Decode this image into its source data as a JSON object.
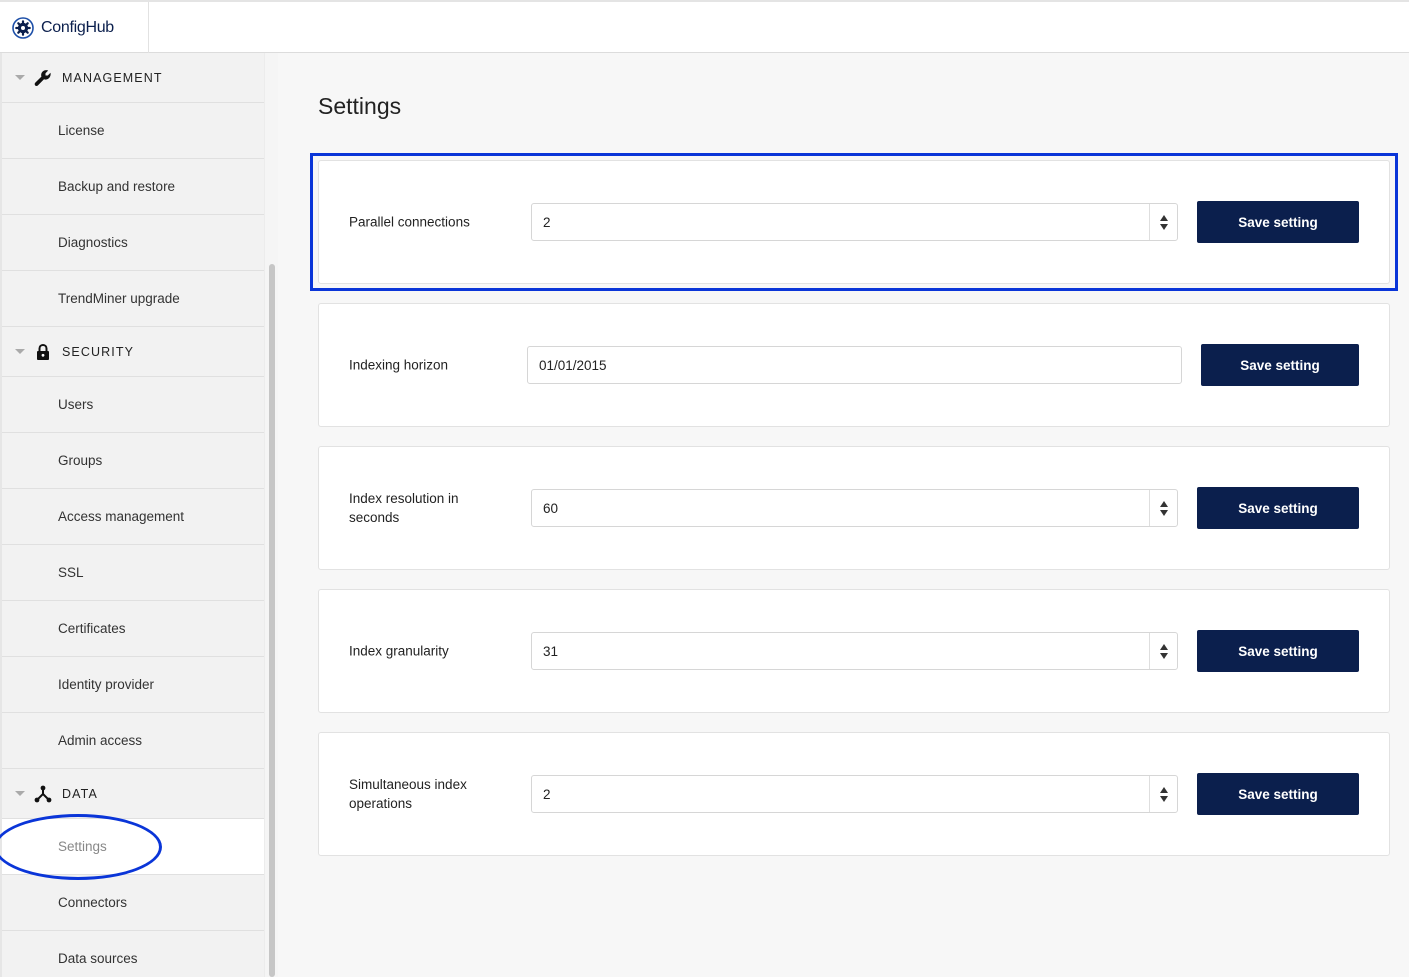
{
  "app": {
    "brand_name": "ConfigHub"
  },
  "sidebar": {
    "sections": [
      {
        "label": "MANAGEMENT",
        "icon": "wrench-icon",
        "items": [
          "License",
          "Backup and restore",
          "Diagnostics",
          "TrendMiner upgrade"
        ]
      },
      {
        "label": "SECURITY",
        "icon": "lock-icon",
        "items": [
          "Users",
          "Groups",
          "Access management",
          "SSL",
          "Certificates",
          "Identity provider",
          "Admin access"
        ]
      },
      {
        "label": "DATA",
        "icon": "network-icon",
        "items": [
          "Settings",
          "Connectors",
          "Data sources"
        ]
      }
    ],
    "active_item": "Settings"
  },
  "main": {
    "title": "Settings",
    "settings": [
      {
        "label": "Parallel connections",
        "value": "2",
        "type": "number",
        "button": "Save setting"
      },
      {
        "label": "Indexing horizon",
        "value": "01/01/2015",
        "type": "date",
        "button": "Save setting"
      },
      {
        "label": "Index resolution in seconds",
        "value": "60",
        "type": "number",
        "button": "Save setting"
      },
      {
        "label": "Index granularity",
        "value": "31",
        "type": "number",
        "button": "Save setting"
      },
      {
        "label": "Simultaneous index operations",
        "value": "2",
        "type": "number",
        "button": "Save setting"
      }
    ]
  },
  "colors": {
    "accent": "#0b1f4d",
    "highlight": "#0a35d8",
    "sidebar_bg": "#f2f2f2"
  }
}
